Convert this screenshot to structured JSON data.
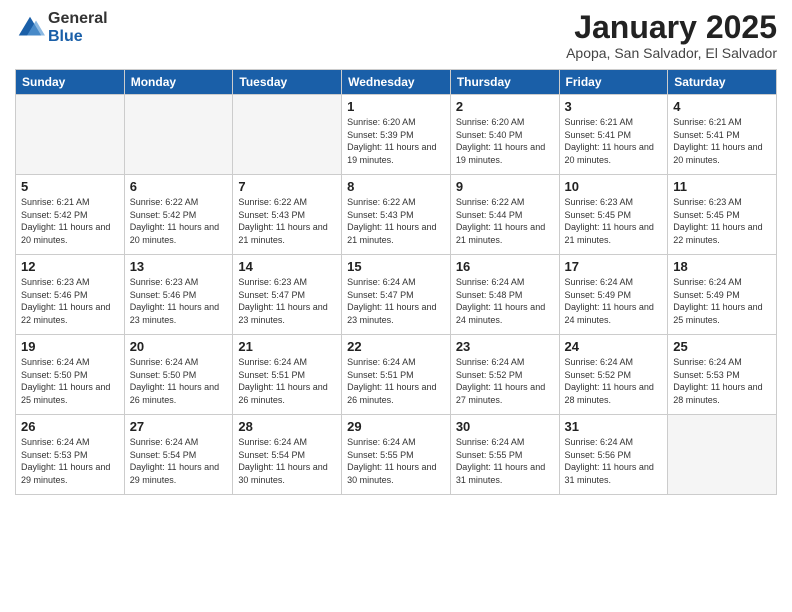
{
  "logo": {
    "general": "General",
    "blue": "Blue"
  },
  "title": "January 2025",
  "location": "Apopa, San Salvador, El Salvador",
  "days_of_week": [
    "Sunday",
    "Monday",
    "Tuesday",
    "Wednesday",
    "Thursday",
    "Friday",
    "Saturday"
  ],
  "weeks": [
    [
      {
        "day": "",
        "info": ""
      },
      {
        "day": "",
        "info": ""
      },
      {
        "day": "",
        "info": ""
      },
      {
        "day": "1",
        "info": "Sunrise: 6:20 AM\nSunset: 5:39 PM\nDaylight: 11 hours\nand 19 minutes."
      },
      {
        "day": "2",
        "info": "Sunrise: 6:20 AM\nSunset: 5:40 PM\nDaylight: 11 hours\nand 19 minutes."
      },
      {
        "day": "3",
        "info": "Sunrise: 6:21 AM\nSunset: 5:41 PM\nDaylight: 11 hours\nand 20 minutes."
      },
      {
        "day": "4",
        "info": "Sunrise: 6:21 AM\nSunset: 5:41 PM\nDaylight: 11 hours\nand 20 minutes."
      }
    ],
    [
      {
        "day": "5",
        "info": "Sunrise: 6:21 AM\nSunset: 5:42 PM\nDaylight: 11 hours\nand 20 minutes."
      },
      {
        "day": "6",
        "info": "Sunrise: 6:22 AM\nSunset: 5:42 PM\nDaylight: 11 hours\nand 20 minutes."
      },
      {
        "day": "7",
        "info": "Sunrise: 6:22 AM\nSunset: 5:43 PM\nDaylight: 11 hours\nand 21 minutes."
      },
      {
        "day": "8",
        "info": "Sunrise: 6:22 AM\nSunset: 5:43 PM\nDaylight: 11 hours\nand 21 minutes."
      },
      {
        "day": "9",
        "info": "Sunrise: 6:22 AM\nSunset: 5:44 PM\nDaylight: 11 hours\nand 21 minutes."
      },
      {
        "day": "10",
        "info": "Sunrise: 6:23 AM\nSunset: 5:45 PM\nDaylight: 11 hours\nand 21 minutes."
      },
      {
        "day": "11",
        "info": "Sunrise: 6:23 AM\nSunset: 5:45 PM\nDaylight: 11 hours\nand 22 minutes."
      }
    ],
    [
      {
        "day": "12",
        "info": "Sunrise: 6:23 AM\nSunset: 5:46 PM\nDaylight: 11 hours\nand 22 minutes."
      },
      {
        "day": "13",
        "info": "Sunrise: 6:23 AM\nSunset: 5:46 PM\nDaylight: 11 hours\nand 23 minutes."
      },
      {
        "day": "14",
        "info": "Sunrise: 6:23 AM\nSunset: 5:47 PM\nDaylight: 11 hours\nand 23 minutes."
      },
      {
        "day": "15",
        "info": "Sunrise: 6:24 AM\nSunset: 5:47 PM\nDaylight: 11 hours\nand 23 minutes."
      },
      {
        "day": "16",
        "info": "Sunrise: 6:24 AM\nSunset: 5:48 PM\nDaylight: 11 hours\nand 24 minutes."
      },
      {
        "day": "17",
        "info": "Sunrise: 6:24 AM\nSunset: 5:49 PM\nDaylight: 11 hours\nand 24 minutes."
      },
      {
        "day": "18",
        "info": "Sunrise: 6:24 AM\nSunset: 5:49 PM\nDaylight: 11 hours\nand 25 minutes."
      }
    ],
    [
      {
        "day": "19",
        "info": "Sunrise: 6:24 AM\nSunset: 5:50 PM\nDaylight: 11 hours\nand 25 minutes."
      },
      {
        "day": "20",
        "info": "Sunrise: 6:24 AM\nSunset: 5:50 PM\nDaylight: 11 hours\nand 26 minutes."
      },
      {
        "day": "21",
        "info": "Sunrise: 6:24 AM\nSunset: 5:51 PM\nDaylight: 11 hours\nand 26 minutes."
      },
      {
        "day": "22",
        "info": "Sunrise: 6:24 AM\nSunset: 5:51 PM\nDaylight: 11 hours\nand 26 minutes."
      },
      {
        "day": "23",
        "info": "Sunrise: 6:24 AM\nSunset: 5:52 PM\nDaylight: 11 hours\nand 27 minutes."
      },
      {
        "day": "24",
        "info": "Sunrise: 6:24 AM\nSunset: 5:52 PM\nDaylight: 11 hours\nand 28 minutes."
      },
      {
        "day": "25",
        "info": "Sunrise: 6:24 AM\nSunset: 5:53 PM\nDaylight: 11 hours\nand 28 minutes."
      }
    ],
    [
      {
        "day": "26",
        "info": "Sunrise: 6:24 AM\nSunset: 5:53 PM\nDaylight: 11 hours\nand 29 minutes."
      },
      {
        "day": "27",
        "info": "Sunrise: 6:24 AM\nSunset: 5:54 PM\nDaylight: 11 hours\nand 29 minutes."
      },
      {
        "day": "28",
        "info": "Sunrise: 6:24 AM\nSunset: 5:54 PM\nDaylight: 11 hours\nand 30 minutes."
      },
      {
        "day": "29",
        "info": "Sunrise: 6:24 AM\nSunset: 5:55 PM\nDaylight: 11 hours\nand 30 minutes."
      },
      {
        "day": "30",
        "info": "Sunrise: 6:24 AM\nSunset: 5:55 PM\nDaylight: 11 hours\nand 31 minutes."
      },
      {
        "day": "31",
        "info": "Sunrise: 6:24 AM\nSunset: 5:56 PM\nDaylight: 11 hours\nand 31 minutes."
      },
      {
        "day": "",
        "info": ""
      }
    ]
  ]
}
